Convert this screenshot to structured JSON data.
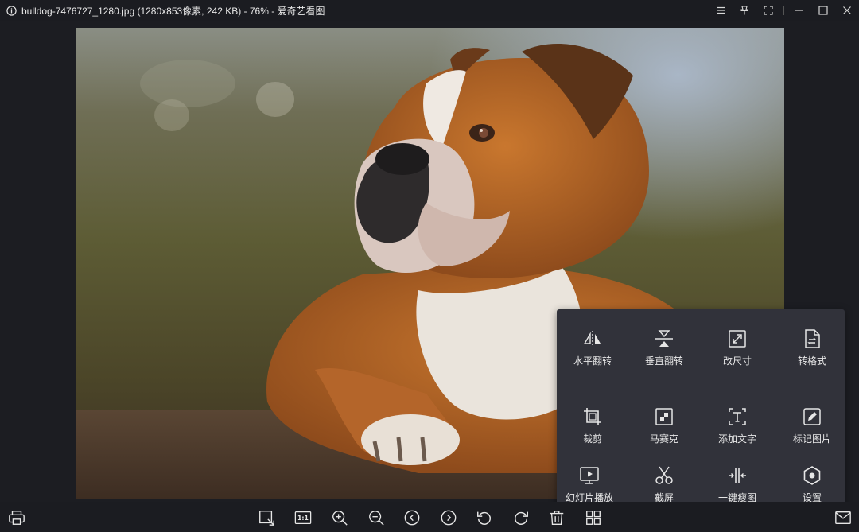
{
  "titlebar": {
    "title": "bulldog-7476727_1280.jpg (1280x853像素, 242 KB) - 76% - 爱奇艺看图",
    "icons": [
      "info-icon",
      "menu-icon",
      "pin-icon",
      "fullscreen-icon",
      "minimize-icon",
      "maximize-icon",
      "close-icon"
    ]
  },
  "tools": {
    "items": [
      {
        "label": "水平翻转",
        "icon": "flip-horizontal-icon"
      },
      {
        "label": "垂直翻转",
        "icon": "flip-vertical-icon"
      },
      {
        "label": "改尺寸",
        "icon": "resize-icon"
      },
      {
        "label": "转格式",
        "icon": "convert-format-icon"
      },
      {
        "label": "裁剪",
        "icon": "crop-icon"
      },
      {
        "label": "马赛克",
        "icon": "mosaic-icon"
      },
      {
        "label": "添加文字",
        "icon": "add-text-icon"
      },
      {
        "label": "标记图片",
        "icon": "mark-icon"
      },
      {
        "label": "幻灯片播放",
        "icon": "slideshow-icon"
      },
      {
        "label": "截屏",
        "icon": "scissors-icon"
      },
      {
        "label": "一键瘦图",
        "icon": "compress-icon"
      },
      {
        "label": "设置",
        "icon": "settings-icon"
      }
    ]
  },
  "toolbar": {
    "icons": [
      "print-icon",
      "fit-window-icon",
      "actual-size-icon",
      "zoom-in-icon",
      "zoom-out-icon",
      "previous-icon",
      "next-icon",
      "rotate-left-icon",
      "rotate-right-icon",
      "delete-icon",
      "grid-icon",
      "mail-icon"
    ],
    "actual_size_label": "1:1"
  },
  "colors": {
    "background": "#1c1d22",
    "panel": "#31323a",
    "icon": "#e6e6e6"
  }
}
